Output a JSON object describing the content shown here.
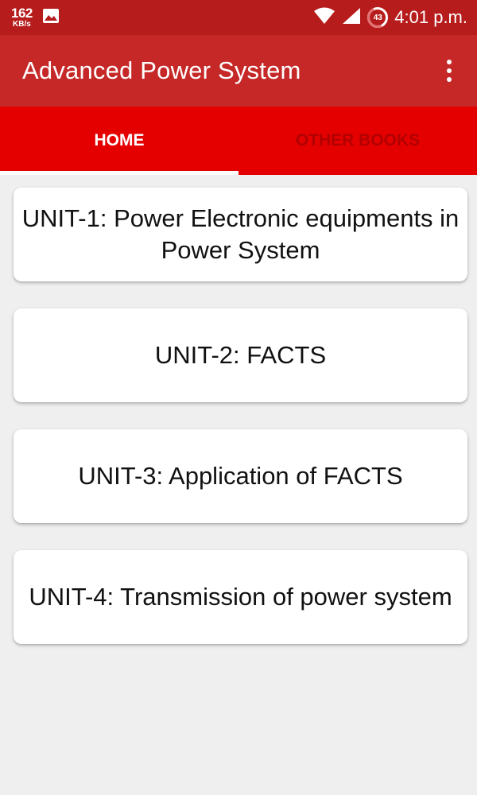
{
  "status_bar": {
    "net_speed_value": "162",
    "net_speed_unit": "KB/s",
    "battery_level": "43",
    "time": "4:01 p.m."
  },
  "app_bar": {
    "title": "Advanced Power System"
  },
  "tabs": [
    {
      "label": "HOME",
      "active": true
    },
    {
      "label": "OTHER BOOKS",
      "active": false
    }
  ],
  "units": [
    {
      "label": "UNIT-1: Power Electronic equipments in Power System"
    },
    {
      "label": "UNIT-2: FACTS"
    },
    {
      "label": "UNIT-3: Application of FACTS"
    },
    {
      "label": "UNIT-4: Transmission of power system"
    }
  ],
  "colors": {
    "status_bar": "#b71c1c",
    "app_bar": "#c62828",
    "tab_bar": "#e50000",
    "background": "#efefef"
  },
  "icons": [
    "image-icon",
    "wifi-icon",
    "cell-signal-icon",
    "battery-icon",
    "more-vert-icon"
  ]
}
